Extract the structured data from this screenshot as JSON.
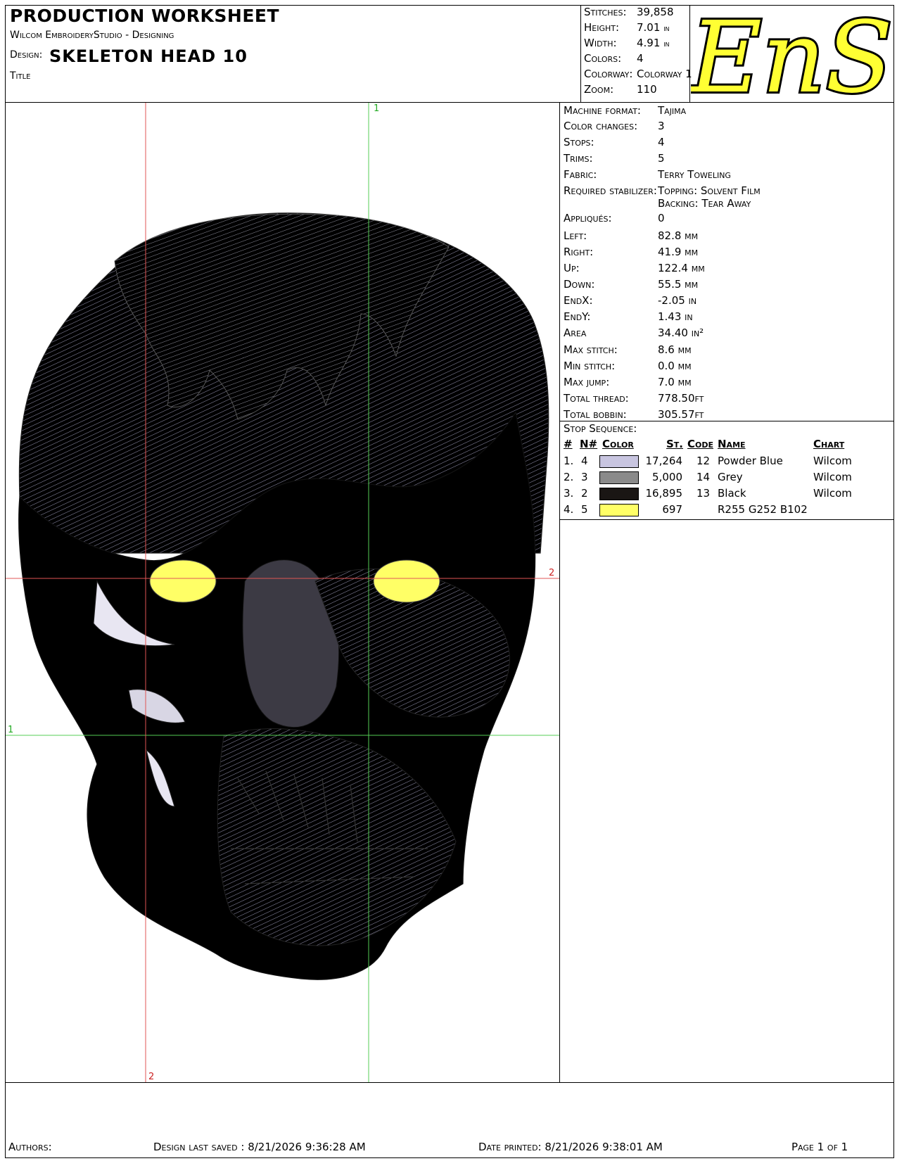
{
  "header": {
    "title": "PRODUCTION WORKSHEET",
    "software": "Wilcom EmbroideryStudio - Designing",
    "design_label": "Design:",
    "design_name": "SKELETON HEAD  10",
    "title_label": "Title"
  },
  "stats": [
    {
      "label": "Stitches:",
      "value": "39,858",
      "unit": ""
    },
    {
      "label": "Height:",
      "value": "7.01",
      "unit": "in"
    },
    {
      "label": "Width:",
      "value": "4.91",
      "unit": "in"
    },
    {
      "label": "Colors:",
      "value": "4",
      "unit": ""
    },
    {
      "label": "Colorway:",
      "value": "Colorway 1",
      "unit": ""
    },
    {
      "label": "Zoom:",
      "value": "110",
      "unit": ""
    }
  ],
  "logo": {
    "text": "EnS",
    "fill": "#ffff33",
    "outline": "#000000"
  },
  "info": [
    {
      "label": "Machine format:",
      "value": "Tajima"
    },
    {
      "label": "Color changes:",
      "value": "3"
    },
    {
      "label": "Stops:",
      "value": "4"
    },
    {
      "label": "Trims:",
      "value": "5"
    },
    {
      "label": "Fabric:",
      "value": "Terry Toweling"
    },
    {
      "label": "Required stabilizer:",
      "value": "Topping: Solvent Film",
      "value2": "Backing: Tear Away"
    },
    {
      "label": "Appliqués:",
      "value": "0"
    },
    {
      "label": "Left:",
      "value": "82.8 mm"
    },
    {
      "label": "Right:",
      "value": "41.9 mm"
    },
    {
      "label": "Up:",
      "value": "122.4 mm"
    },
    {
      "label": "Down:",
      "value": "55.5 mm"
    },
    {
      "label": "EndX:",
      "value": "-2.05 in"
    },
    {
      "label": "EndY:",
      "value": "1.43 in"
    },
    {
      "label": "Area",
      "value": "34.40 in²"
    },
    {
      "label": "Max stitch:",
      "value": "8.6 mm"
    },
    {
      "label": "Min stitch:",
      "value": "0.0 mm"
    },
    {
      "label": "Max jump:",
      "value": "7.0 mm"
    },
    {
      "label": "Total thread:",
      "value": "778.50ft"
    },
    {
      "label": "Total bobbin:",
      "value": "305.57ft"
    }
  ],
  "stop_sequence": {
    "title": "Stop Sequence:",
    "headers": {
      "num": "#",
      "n": "N#",
      "color": "Color",
      "stitches": "St.",
      "code": "Code",
      "name": "Name",
      "chart": "Chart"
    },
    "rows": [
      {
        "num": "1.",
        "n": "4",
        "color": "#c8c5e0",
        "stitches": "17,264",
        "code": "12",
        "name": "Powder Blue",
        "chart": "Wilcom"
      },
      {
        "num": "2.",
        "n": "3",
        "color": "#8a8a8a",
        "stitches": "5,000",
        "code": "14",
        "name": "Grey",
        "chart": "Wilcom"
      },
      {
        "num": "3.",
        "n": "2",
        "color": "#1a1614",
        "stitches": "16,895",
        "code": "13",
        "name": "Black",
        "chart": "Wilcom"
      },
      {
        "num": "4.",
        "n": "5",
        "color": "#ffff66",
        "stitches": "697",
        "code": "",
        "name": "R255 G252 B102",
        "chart": ""
      }
    ]
  },
  "canvas": {
    "guide_labels": {
      "top": "1",
      "left": "1",
      "right": "2",
      "bottom": "2"
    }
  },
  "footer": {
    "authors_label": "Authors:",
    "saved_label": "Design last saved :",
    "saved_value": "8/21/2026 9:36:28 AM",
    "printed_label": "Date printed:",
    "printed_value": "8/21/2026 9:38:01 AM",
    "page": "Page 1 of 1"
  }
}
